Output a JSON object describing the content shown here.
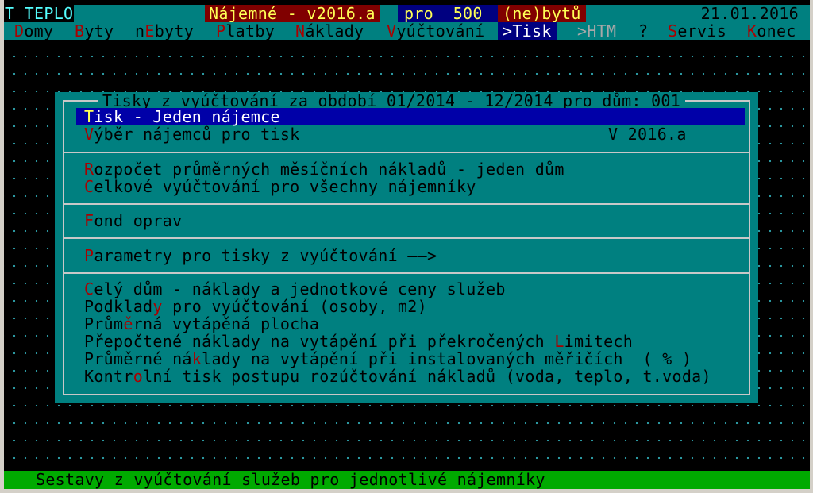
{
  "title_bar": {
    "app_name": "T_TEPLO",
    "name": "Nájemné - v2016.a",
    "pro_label": "pro  500",
    "units_label": "(ne)bytů",
    "date": "21.01.2016"
  },
  "menu": [
    {
      "hotkey": "D",
      "rest": "omy"
    },
    {
      "hotkey": "B",
      "rest": "yty"
    },
    {
      "pre": "n",
      "hotkey": "E",
      "rest": "byty"
    },
    {
      "hotkey": "P",
      "rest": "latby"
    },
    {
      "hotkey": "N",
      "rest": "áklady"
    },
    {
      "hotkey": "V",
      "rest": "yúčtování"
    },
    {
      "label": ">Tisk",
      "active": true
    },
    {
      "label": ">HTM",
      "disabled": true
    },
    {
      "label": "?"
    },
    {
      "hotkey": "S",
      "rest": "ervis"
    },
    {
      "hotkey": "K",
      "rest": "onec"
    }
  ],
  "dialog": {
    "title": "Tisky z vyúčtování za období 01/2014 - 12/2014 pro dům: 001",
    "version": "V 2016.a",
    "groups": [
      [
        {
          "hotkey": "T",
          "rest": "isk - Jeden nájemce",
          "selected": true
        },
        {
          "hotkey": "V",
          "rest": "ýběr nájemců pro tisk"
        }
      ],
      [
        {
          "hotkey": "R",
          "rest": "ozpočet průměrných měsíčních nákladů - jeden dům"
        },
        {
          "hotkey": "C",
          "rest": "elkové vyúčtování pro všechny nájemníky"
        }
      ],
      [
        {
          "hotkey": "F",
          "rest": "ond oprav"
        }
      ],
      [
        {
          "hotkey": "P",
          "rest": "arametry pro tisky z vyúčtování ——>"
        }
      ],
      [
        {
          "hotkey": "C",
          "rest": "elý dům - náklady a jednotkové ceny služeb"
        },
        {
          "pre": "Podklad",
          "hotkey": "y",
          "rest": " pro vyúčtování (osoby, m2)"
        },
        {
          "pre": "Prům",
          "hotkey": "ě",
          "rest": "rná vytápěná plocha"
        },
        {
          "pre": "Přepočtené náklady na vytápění při překročených ",
          "hotkey": "L",
          "rest": "imitech"
        },
        {
          "pre": "Průměrné ná",
          "hotkey": "k",
          "rest": "lady na vytápění při instalovaných měřičích  ( % )"
        },
        {
          "pre": "Kontr",
          "hotkey": "o",
          "rest": "lní tisk postupu rozúčtování nákladů (voda, teplo, t.voda)"
        }
      ]
    ]
  },
  "status_bar": {
    "text": "Sestavy z vyúčtování služeb pro jednotlivé nájemníky"
  },
  "colors": {
    "teal": "#008080",
    "dialog_bg": "#008080",
    "selection": "#0000a8",
    "hotkey": "#aa0000",
    "status": "#00aa00"
  }
}
